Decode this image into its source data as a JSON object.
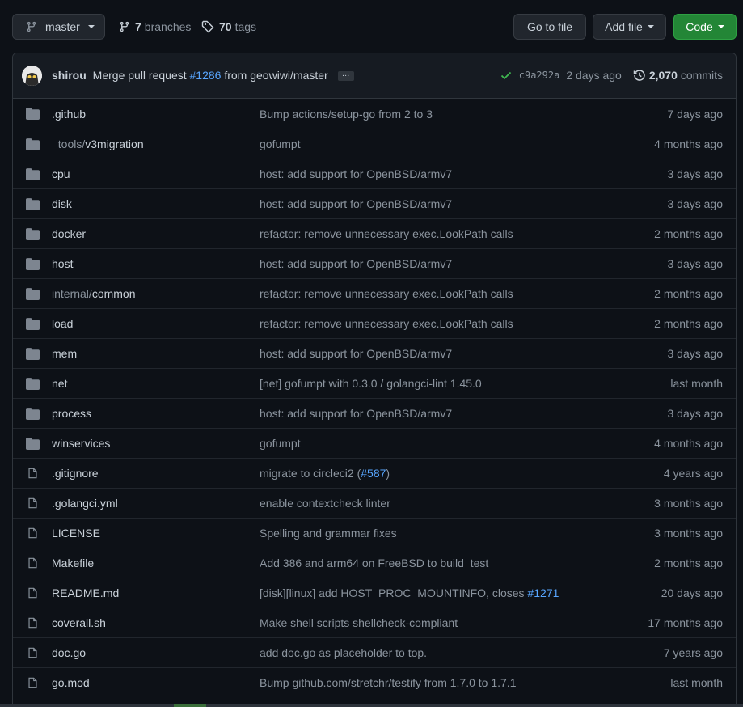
{
  "toolbar": {
    "branch_label": "master",
    "branches_count": "7",
    "branches_label": "branches",
    "tags_count": "70",
    "tags_label": "tags",
    "go_to_file_label": "Go to file",
    "add_file_label": "Add file",
    "code_label": "Code"
  },
  "commit": {
    "author": "shirou",
    "message_prefix": "Merge pull request",
    "pr_link": "#1286",
    "message_suffix": "from geowiwi/master",
    "ellipsis": "…",
    "sha": "c9a292a",
    "time": "2 days ago",
    "commits_count": "2,070",
    "commits_label": "commits"
  },
  "files": [
    {
      "type": "dir",
      "name_dim": "",
      "name": ".github",
      "msg": "Bump actions/setup-go from 2 to 3",
      "msg_link": "",
      "msg_suffix": "",
      "time": "7 days ago"
    },
    {
      "type": "dir",
      "name_dim": "_tools/",
      "name": "v3migration",
      "msg": "gofumpt",
      "msg_link": "",
      "msg_suffix": "",
      "time": "4 months ago"
    },
    {
      "type": "dir",
      "name_dim": "",
      "name": "cpu",
      "msg": "host: add support for OpenBSD/armv7",
      "msg_link": "",
      "msg_suffix": "",
      "time": "3 days ago"
    },
    {
      "type": "dir",
      "name_dim": "",
      "name": "disk",
      "msg": "host: add support for OpenBSD/armv7",
      "msg_link": "",
      "msg_suffix": "",
      "time": "3 days ago"
    },
    {
      "type": "dir",
      "name_dim": "",
      "name": "docker",
      "msg": "refactor: remove unnecessary exec.LookPath calls",
      "msg_link": "",
      "msg_suffix": "",
      "time": "2 months ago"
    },
    {
      "type": "dir",
      "name_dim": "",
      "name": "host",
      "msg": "host: add support for OpenBSD/armv7",
      "msg_link": "",
      "msg_suffix": "",
      "time": "3 days ago"
    },
    {
      "type": "dir",
      "name_dim": "internal/",
      "name": "common",
      "msg": "refactor: remove unnecessary exec.LookPath calls",
      "msg_link": "",
      "msg_suffix": "",
      "time": "2 months ago"
    },
    {
      "type": "dir",
      "name_dim": "",
      "name": "load",
      "msg": "refactor: remove unnecessary exec.LookPath calls",
      "msg_link": "",
      "msg_suffix": "",
      "time": "2 months ago"
    },
    {
      "type": "dir",
      "name_dim": "",
      "name": "mem",
      "msg": "host: add support for OpenBSD/armv7",
      "msg_link": "",
      "msg_suffix": "",
      "time": "3 days ago"
    },
    {
      "type": "dir",
      "name_dim": "",
      "name": "net",
      "msg": "[net] gofumpt with 0.3.0 / golangci-lint 1.45.0",
      "msg_link": "",
      "msg_suffix": "",
      "time": "last month"
    },
    {
      "type": "dir",
      "name_dim": "",
      "name": "process",
      "msg": "host: add support for OpenBSD/armv7",
      "msg_link": "",
      "msg_suffix": "",
      "time": "3 days ago"
    },
    {
      "type": "dir",
      "name_dim": "",
      "name": "winservices",
      "msg": "gofumpt",
      "msg_link": "",
      "msg_suffix": "",
      "time": "4 months ago"
    },
    {
      "type": "file",
      "name_dim": "",
      "name": ".gitignore",
      "msg": "migrate to circleci2 (",
      "msg_link": "#587",
      "msg_suffix": ")",
      "time": "4 years ago"
    },
    {
      "type": "file",
      "name_dim": "",
      "name": ".golangci.yml",
      "msg": "enable contextcheck linter",
      "msg_link": "",
      "msg_suffix": "",
      "time": "3 months ago"
    },
    {
      "type": "file",
      "name_dim": "",
      "name": "LICENSE",
      "msg": "Spelling and grammar fixes",
      "msg_link": "",
      "msg_suffix": "",
      "time": "3 months ago"
    },
    {
      "type": "file",
      "name_dim": "",
      "name": "Makefile",
      "msg": "Add 386 and arm64 on FreeBSD to build_test",
      "msg_link": "",
      "msg_suffix": "",
      "time": "2 months ago"
    },
    {
      "type": "file",
      "name_dim": "",
      "name": "README.md",
      "msg": "[disk][linux] add HOST_PROC_MOUNTINFO, closes ",
      "msg_link": "#1271",
      "msg_suffix": "",
      "time": "20 days ago"
    },
    {
      "type": "file",
      "name_dim": "",
      "name": "coverall.sh",
      "msg": "Make shell scripts shellcheck-compliant",
      "msg_link": "",
      "msg_suffix": "",
      "time": "17 months ago"
    },
    {
      "type": "file",
      "name_dim": "",
      "name": "doc.go",
      "msg": "add doc.go as placeholder to top.",
      "msg_link": "",
      "msg_suffix": "",
      "time": "7 years ago"
    },
    {
      "type": "file",
      "name_dim": "",
      "name": "go.mod",
      "msg": "Bump github.com/stretchr/testify from 1.7.0 to 1.7.1",
      "msg_link": "",
      "msg_suffix": "",
      "time": "last month"
    }
  ],
  "colors": {
    "background": "#0d1117",
    "link": "#58a6ff",
    "code_button": "#238636",
    "success_check": "#3fb950",
    "folder_icon": "#7d8590"
  }
}
